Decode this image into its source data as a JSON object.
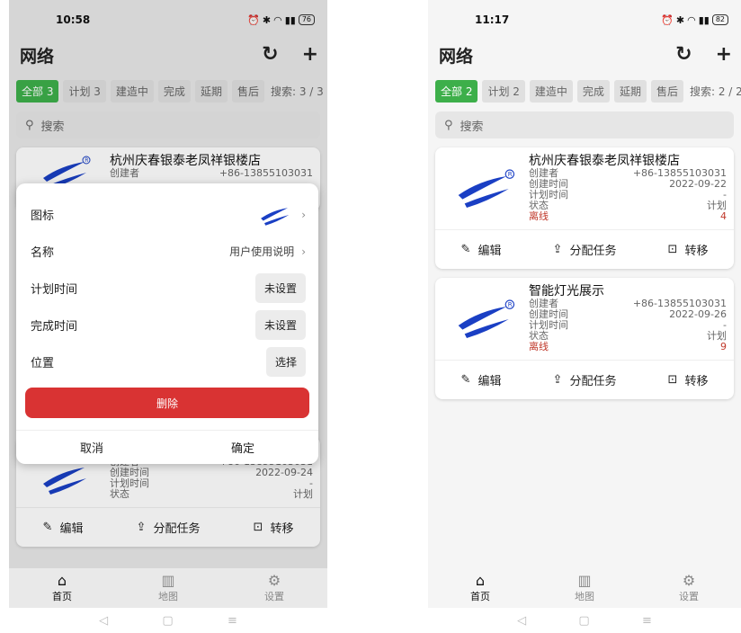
{
  "left": {
    "status": {
      "time": "10:58",
      "battery": "76"
    },
    "title": "网络",
    "filters": [
      {
        "label": "全部 3",
        "active": true
      },
      {
        "label": "计划 3"
      },
      {
        "label": "建造中"
      },
      {
        "label": "完成"
      },
      {
        "label": "延期"
      },
      {
        "label": "售后"
      }
    ],
    "search_count": "搜索: 3 / 3",
    "search_placeholder": "搜索",
    "card_top": {
      "name": "杭州庆春银泰老凤祥银楼店",
      "creator_label": "创建者",
      "creator_value": "+86-13855103031"
    },
    "card_bottom": {
      "creator_label": "创建者",
      "creator_value": "+86-13855103031",
      "created_label": "创建时间",
      "created_value": "2022-09-24",
      "plan_label": "计划时间",
      "plan_value": "-",
      "state_label": "状态",
      "state_value": "计划"
    },
    "actions": {
      "edit": "编辑",
      "assign": "分配任务",
      "transfer": "转移"
    },
    "dialog": {
      "icon_label": "图标",
      "name_label": "名称",
      "name_value": "用户使用说明",
      "plan_label": "计划时间",
      "plan_value": "未设置",
      "done_label": "完成时间",
      "done_value": "未设置",
      "location_label": "位置",
      "location_value": "选择",
      "delete": "删除",
      "cancel": "取消",
      "ok": "确定"
    },
    "nav": {
      "home": "首页",
      "map": "地图",
      "settings": "设置"
    }
  },
  "right": {
    "status": {
      "time": "11:17",
      "battery": "82"
    },
    "title": "网络",
    "filters": [
      {
        "label": "全部 2",
        "active": true
      },
      {
        "label": "计划 2"
      },
      {
        "label": "建造中"
      },
      {
        "label": "完成"
      },
      {
        "label": "延期"
      },
      {
        "label": "售后"
      }
    ],
    "search_count": "搜索: 2 / 2",
    "search_placeholder": "搜索",
    "cards": [
      {
        "name": "杭州庆春银泰老凤祥银楼店",
        "creator_label": "创建者",
        "creator_value": "+86-13855103031",
        "created_label": "创建时间",
        "created_value": "2022-09-22",
        "plan_label": "计划时间",
        "plan_value": "-",
        "state_label": "状态",
        "state_value": "计划",
        "offline_label": "离线",
        "offline_value": "4"
      },
      {
        "name": "智能灯光展示",
        "creator_label": "创建者",
        "creator_value": "+86-13855103031",
        "created_label": "创建时间",
        "created_value": "2022-09-26",
        "plan_label": "计划时间",
        "plan_value": "-",
        "state_label": "状态",
        "state_value": "计划",
        "offline_label": "离线",
        "offline_value": "9"
      }
    ],
    "actions": {
      "edit": "编辑",
      "assign": "分配任务",
      "transfer": "转移"
    },
    "nav": {
      "home": "首页",
      "map": "地图",
      "settings": "设置"
    }
  },
  "colors": {
    "accent": "#3daf4a",
    "danger": "#d93333",
    "offline": "#c0392b",
    "logo_blue": "#1a3fc4"
  }
}
